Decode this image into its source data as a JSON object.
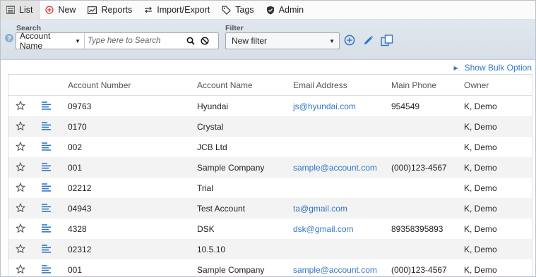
{
  "toolbar": {
    "items": [
      {
        "label": "List",
        "icon": "list-icon"
      },
      {
        "label": "New",
        "icon": "add-circle-icon"
      },
      {
        "label": "Reports",
        "icon": "reports-icon"
      },
      {
        "label": "Import/Export",
        "icon": "import-export-icon"
      },
      {
        "label": "Tags",
        "icon": "tag-icon"
      },
      {
        "label": "Admin",
        "icon": "shield-icon"
      }
    ]
  },
  "search": {
    "label": "Search",
    "field": "Account Name",
    "placeholder": "Type here to Search"
  },
  "filter": {
    "label": "Filter",
    "selected": "New filter"
  },
  "bulk_option": "Show Bulk Option",
  "table": {
    "columns": [
      "Account Number",
      "Account Name",
      "Email Address",
      "Main Phone",
      "Owner"
    ],
    "rows": [
      {
        "number": "09763",
        "name": "Hyundai",
        "email": "js@hyundai.com",
        "phone": "954549",
        "owner": "K, Demo"
      },
      {
        "number": "0170",
        "name": "Crystal",
        "email": "",
        "phone": "",
        "owner": "K, Demo"
      },
      {
        "number": "002",
        "name": "JCB Ltd",
        "email": "",
        "phone": "",
        "owner": "K, Demo"
      },
      {
        "number": "001",
        "name": "Sample Company",
        "email": "sample@account.com",
        "phone": "(000)123-4567",
        "owner": "K, Demo"
      },
      {
        "number": "02212",
        "name": "Trial",
        "email": "",
        "phone": "",
        "owner": "K, Demo"
      },
      {
        "number": "04943",
        "name": "Test Account",
        "email": "ta@gmail.com",
        "phone": "",
        "owner": "K, Demo"
      },
      {
        "number": "4328",
        "name": "DSK",
        "email": "dsk@gmail.com",
        "phone": "89358395893",
        "owner": "K, Demo"
      },
      {
        "number": "02312",
        "name": "10.5.10",
        "email": "",
        "phone": "",
        "owner": "K, Demo"
      },
      {
        "number": "001",
        "name": "Sample Company",
        "email": "sample@account.com",
        "phone": "(000)123-4567",
        "owner": "K, Demo"
      }
    ]
  },
  "colors": {
    "link": "#2f77c8",
    "accent_red": "#d9363e",
    "panel": "#dde3ea"
  }
}
